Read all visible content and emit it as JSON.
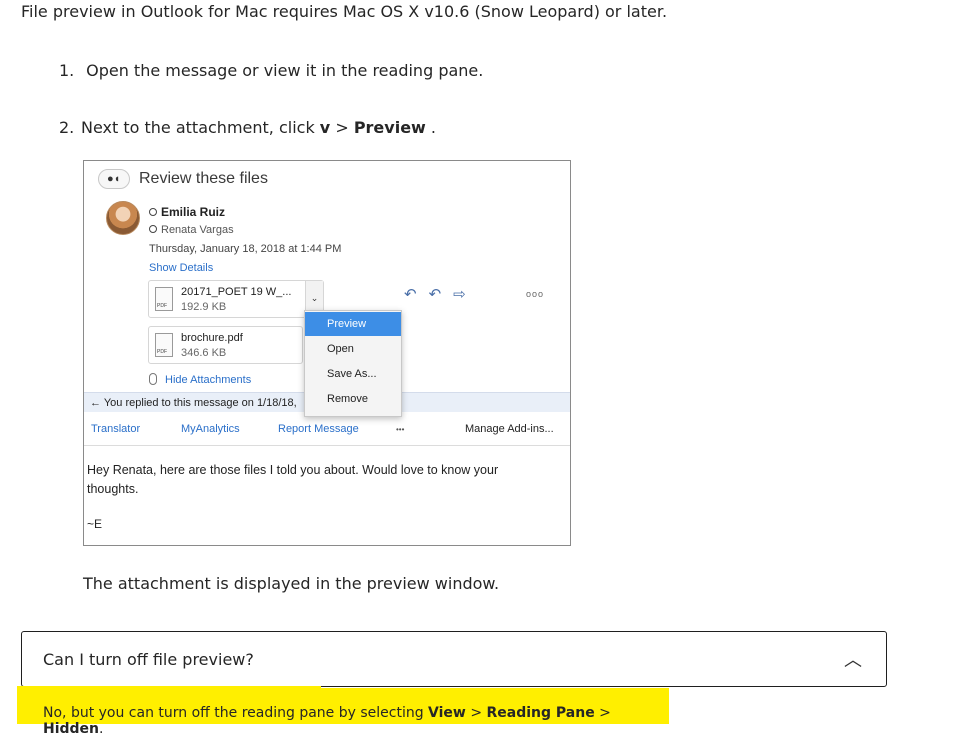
{
  "intro": "File preview in Outlook for Mac requires Mac OS X v10.6 (Snow Leopard) or later.",
  "steps": [
    {
      "num": "1.",
      "text": "Open the message or view it in the reading pane."
    },
    {
      "num": "2.",
      "text_pre": "Next to the attachment, click ",
      "bold1": "v",
      "sep": " > ",
      "bold2": "Preview",
      "post": " ."
    }
  ],
  "email": {
    "subject": "Review these files",
    "from": "Emilia Ruiz",
    "to": "Renata Vargas",
    "date": "Thursday, January 18, 2018 at 1:44 PM",
    "show_details": "Show Details",
    "attachments": [
      {
        "name": "20171_POET 19 W_...",
        "size": "192.9 KB",
        "icon": "PDF"
      },
      {
        "name": "brochure.pdf",
        "size": "346.6 KB",
        "icon": "PDF"
      }
    ],
    "menu": [
      "Preview",
      "Open",
      "Save As...",
      "Remove"
    ],
    "hide_attachments": "Hide Attachments",
    "replied": "You replied to this message on 1/18/18,",
    "addins": [
      "Translator",
      "MyAnalytics",
      "Report Message",
      "•••",
      "Manage Add-ins..."
    ],
    "body": "Hey Renata, here are those files I told you about. Would love to know your thoughts.",
    "signature": "~E",
    "toolbar_icons": [
      "reply-icon",
      "reply-all-icon",
      "forward-icon",
      "more-icon"
    ],
    "more_glyph": "ooo"
  },
  "caption": "The attachment is displayed in the preview window.",
  "faq": {
    "question": "Can I turn off file preview?",
    "answer_pre": "No, but you can turn off the reading pane by selecting ",
    "b1": "View",
    "sep1": " > ",
    "b2": "Reading Pane",
    "sep2": " > ",
    "b3": "Hidden",
    "post": "."
  }
}
